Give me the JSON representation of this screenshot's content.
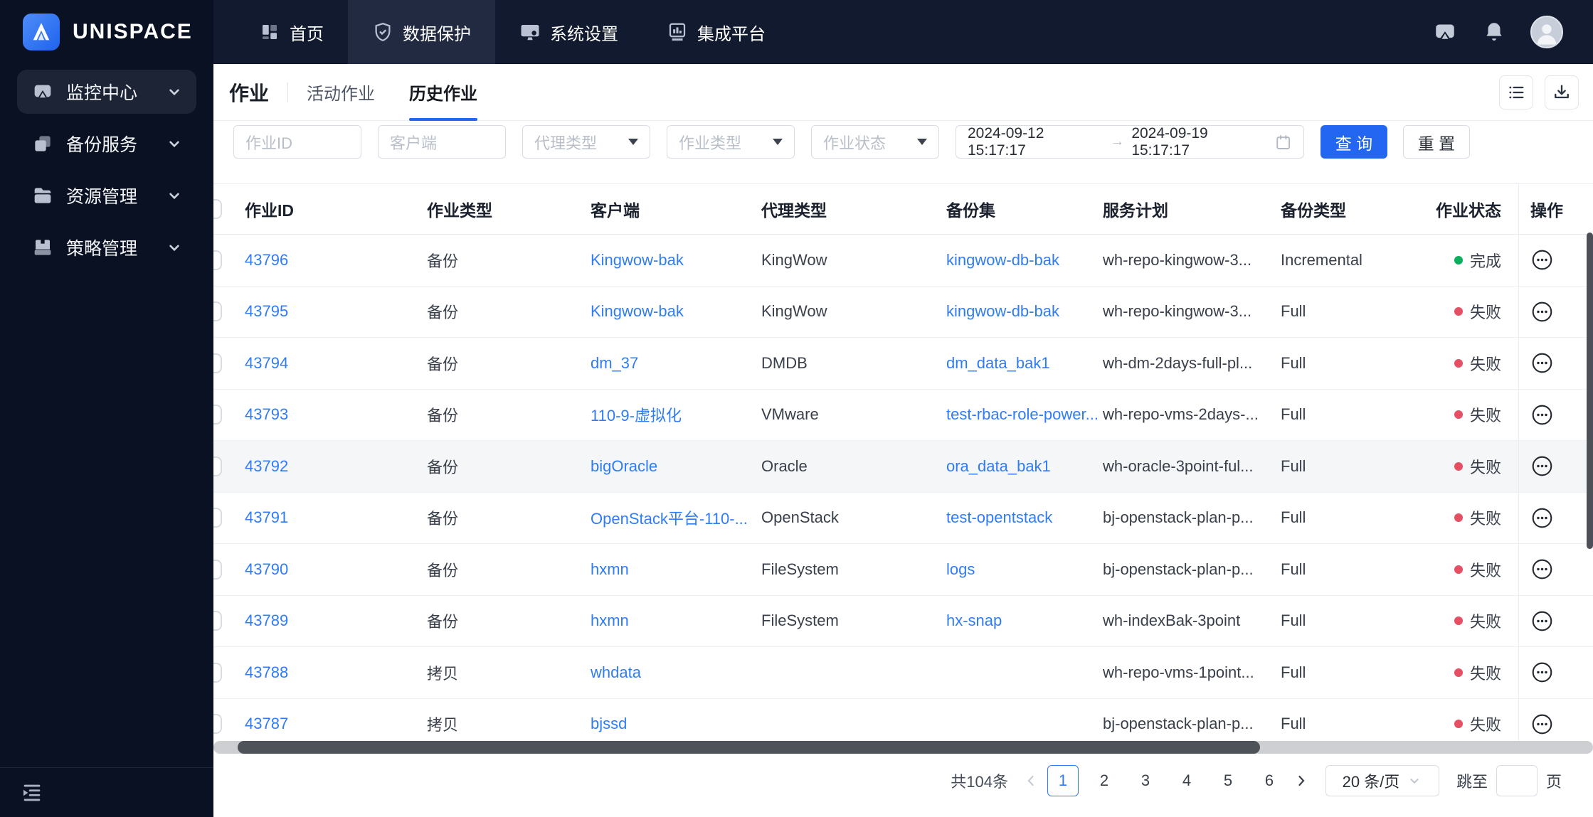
{
  "colors": {
    "accent": "#2266f2",
    "link": "#2f7cf6",
    "success": "#0ab05e",
    "danger": "#e54e63",
    "bar_bg": "#121a2f",
    "bar_dark": "#0a1122",
    "bar_active": "#212a40",
    "side_active": "#1c2436"
  },
  "brand": {
    "name": "UNISPACE"
  },
  "topnav": {
    "items": [
      {
        "label": "首页",
        "active": false
      },
      {
        "label": "数据保护",
        "active": true
      },
      {
        "label": "系统设置",
        "active": false
      },
      {
        "label": "集成平台",
        "active": false
      }
    ]
  },
  "sidebar": {
    "items": [
      {
        "label": "监控中心",
        "active": true
      },
      {
        "label": "备份服务",
        "active": false
      },
      {
        "label": "资源管理",
        "active": false
      },
      {
        "label": "策略管理",
        "active": false
      }
    ]
  },
  "page": {
    "title": "作业",
    "tabs": [
      {
        "label": "活动作业",
        "active": false
      },
      {
        "label": "历史作业",
        "active": true
      }
    ]
  },
  "filters": {
    "job_id_placeholder": "作业ID",
    "client_placeholder": "客户端",
    "agent_type_placeholder": "代理类型",
    "job_type_placeholder": "作业类型",
    "job_status_placeholder": "作业状态",
    "date_start": "2024-09-12 15:17:17",
    "range_separator": "→",
    "date_end": "2024-09-19 15:17:17",
    "search_label": "查 询",
    "reset_label": "重 置"
  },
  "table": {
    "columns": [
      "作业ID",
      "作业类型",
      "客户端",
      "代理类型",
      "备份集",
      "服务计划",
      "备份类型",
      "作业状态",
      "操作"
    ],
    "rows": [
      {
        "id": "43796",
        "type": "备份",
        "client": "Kingwow-bak",
        "agent": "KingWow",
        "backup_set": "kingwow-db-bak",
        "plan": "wh-repo-kingwow-3...",
        "backup_type": "Incremental",
        "status": "完成",
        "status_color": "green",
        "hover": false
      },
      {
        "id": "43795",
        "type": "备份",
        "client": "Kingwow-bak",
        "agent": "KingWow",
        "backup_set": "kingwow-db-bak",
        "plan": "wh-repo-kingwow-3...",
        "backup_type": "Full",
        "status": "失败",
        "status_color": "red",
        "hover": false
      },
      {
        "id": "43794",
        "type": "备份",
        "client": "dm_37",
        "agent": "DMDB",
        "backup_set": "dm_data_bak1",
        "plan": "wh-dm-2days-full-pl...",
        "backup_type": "Full",
        "status": "失败",
        "status_color": "red",
        "hover": false
      },
      {
        "id": "43793",
        "type": "备份",
        "client": "110-9-虚拟化",
        "agent": "VMware",
        "backup_set": "test-rbac-role-power...",
        "plan": "wh-repo-vms-2days-...",
        "backup_type": "Full",
        "status": "失败",
        "status_color": "red",
        "hover": false
      },
      {
        "id": "43792",
        "type": "备份",
        "client": "bigOracle",
        "agent": "Oracle",
        "backup_set": "ora_data_bak1",
        "plan": "wh-oracle-3point-ful...",
        "backup_type": "Full",
        "status": "失败",
        "status_color": "red",
        "hover": true
      },
      {
        "id": "43791",
        "type": "备份",
        "client": "OpenStack平台-110-...",
        "agent": "OpenStack",
        "backup_set": "test-opentstack",
        "plan": "bj-openstack-plan-p...",
        "backup_type": "Full",
        "status": "失败",
        "status_color": "red",
        "hover": false
      },
      {
        "id": "43790",
        "type": "备份",
        "client": "hxmn",
        "agent": "FileSystem",
        "backup_set": "logs",
        "plan": "bj-openstack-plan-p...",
        "backup_type": "Full",
        "status": "失败",
        "status_color": "red",
        "hover": false
      },
      {
        "id": "43789",
        "type": "备份",
        "client": "hxmn",
        "agent": "FileSystem",
        "backup_set": "hx-snap",
        "plan": "wh-indexBak-3point",
        "backup_type": "Full",
        "status": "失败",
        "status_color": "red",
        "hover": false
      },
      {
        "id": "43788",
        "type": "拷贝",
        "client": "whdata",
        "agent": "",
        "backup_set": "",
        "plan": "wh-repo-vms-1point...",
        "backup_type": "Full",
        "status": "失败",
        "status_color": "red",
        "hover": false
      },
      {
        "id": "43787",
        "type": "拷贝",
        "client": "bjssd",
        "agent": "",
        "backup_set": "",
        "plan": "bj-openstack-plan-p...",
        "backup_type": "Full",
        "status": "失败",
        "status_color": "red",
        "hover": false
      }
    ]
  },
  "pagination": {
    "total": "共104条",
    "pages": [
      "1",
      "2",
      "3",
      "4",
      "5",
      "6"
    ],
    "active_page": "1",
    "page_size": "20 条/页",
    "jump_label": "跳至",
    "page_label": "页"
  },
  "icons": {
    "topbar": [
      "home-grid-icon",
      "shield-check-icon",
      "system-settings-icon",
      "integration-chart-icon",
      "message-icon",
      "bell-icon",
      "avatar"
    ],
    "sidebar": [
      "monitor-icon",
      "backup-copy-icon",
      "folder-icon",
      "policy-drive-icon",
      "collapse-sidebar-icon"
    ],
    "toolbar": [
      "list-view-icon",
      "download-icon"
    ],
    "table": [
      "calendar-icon",
      "more-actions-icon",
      "status-dot"
    ]
  }
}
